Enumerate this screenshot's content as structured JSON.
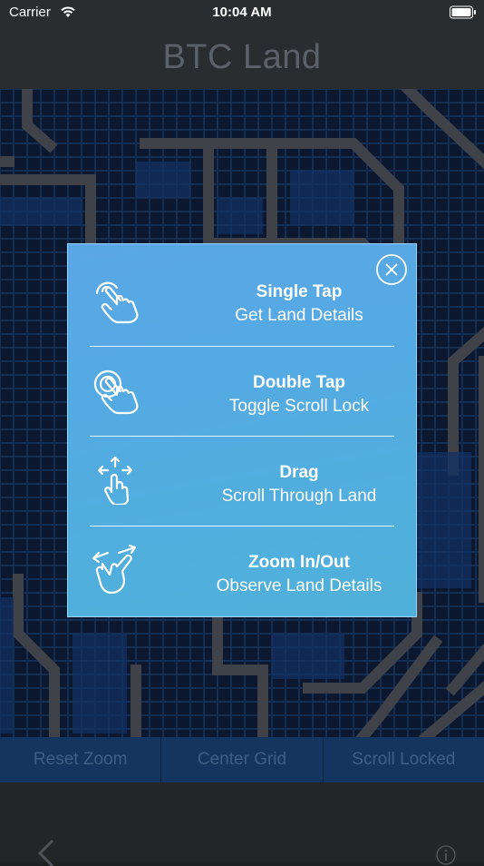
{
  "status_bar": {
    "carrier": "Carrier",
    "time": "10:04 AM"
  },
  "nav": {
    "title": "BTC Land"
  },
  "popup": {
    "items": [
      {
        "title": "Single Tap",
        "subtitle": "Get Land Details",
        "icon": "single-tap-icon"
      },
      {
        "title": "Double Tap",
        "subtitle": "Toggle Scroll Lock",
        "icon": "double-tap-icon"
      },
      {
        "title": "Drag",
        "subtitle": "Scroll Through Land",
        "icon": "drag-icon"
      },
      {
        "title": "Zoom In/Out",
        "subtitle": "Observe Land Details",
        "icon": "pinch-zoom-icon"
      }
    ]
  },
  "bottom_bar": {
    "reset_zoom": "Reset Zoom",
    "center_grid": "Center Grid",
    "scroll_locked": "Scroll Locked"
  },
  "toolbar": {
    "back": "chevron-left-icon",
    "info": "info-icon"
  },
  "colors": {
    "grid_cell": "#0d2d56",
    "grid_line": "#2a4f85",
    "path_gray": "#6b6f74",
    "popup_blue": "#56aae3"
  }
}
